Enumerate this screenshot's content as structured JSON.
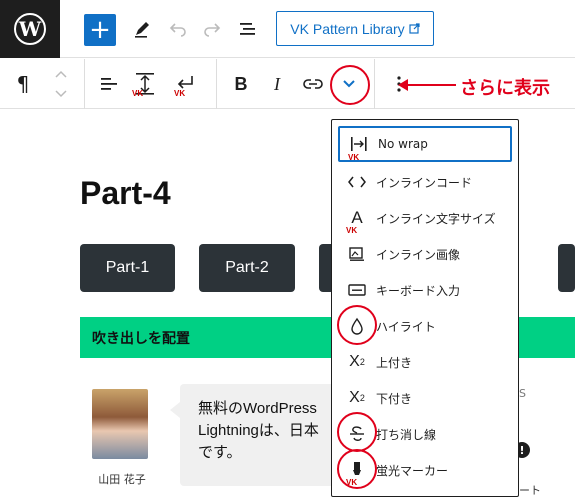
{
  "topbar": {
    "logo_letter": "W",
    "add_symbol": "+",
    "tools_icon": "pencil-icon",
    "undo_icon": "undo-icon",
    "redo_icon": "redo-icon",
    "list_view_icon": "list-view-icon",
    "vk_button_label": "VK Pattern Library",
    "vk_button_icon": "external-link-icon"
  },
  "blockbar": {
    "paragraph_symbol": "¶",
    "bold_label": "B",
    "italic_label": "I",
    "more_rich_text_icon": "chevron-down-icon",
    "options_icon": "more-vertical-icon",
    "vk_mark": "VK"
  },
  "annotation": {
    "text": "さらに表示",
    "color": "#e0001b"
  },
  "content": {
    "title": "Part-4",
    "buttons": [
      "Part-1",
      "Part-2"
    ],
    "green_bar_text": "吹き出しを配置",
    "avatar_name": "山田 花子",
    "bubble_lines": [
      "無料のWordPress",
      "Lightningは、日本",
      "です。"
    ],
    "partial_right_1": "S",
    "partial_right_2": "ート"
  },
  "menu": {
    "items": [
      {
        "label": "No wrap",
        "icon": "no-wrap-icon"
      },
      {
        "label": "インラインコード",
        "icon": "code-icon"
      },
      {
        "label": "インライン文字サイズ",
        "icon": "font-size-icon"
      },
      {
        "label": "インライン画像",
        "icon": "image-icon"
      },
      {
        "label": "キーボード入力",
        "icon": "keyboard-icon"
      },
      {
        "label": "ハイライト",
        "icon": "highlight-drop-icon"
      },
      {
        "label": "上付き",
        "icon": "superscript-icon"
      },
      {
        "label": "下付き",
        "icon": "subscript-icon"
      },
      {
        "label": "打ち消し線",
        "icon": "strikethrough-icon"
      },
      {
        "label": "蛍光マーカー",
        "icon": "marker-icon"
      }
    ]
  },
  "colors": {
    "accent_blue": "#1070c6",
    "green_bar": "#00d084",
    "dark_button": "#2c3338",
    "annotation_red": "#e0001b"
  }
}
